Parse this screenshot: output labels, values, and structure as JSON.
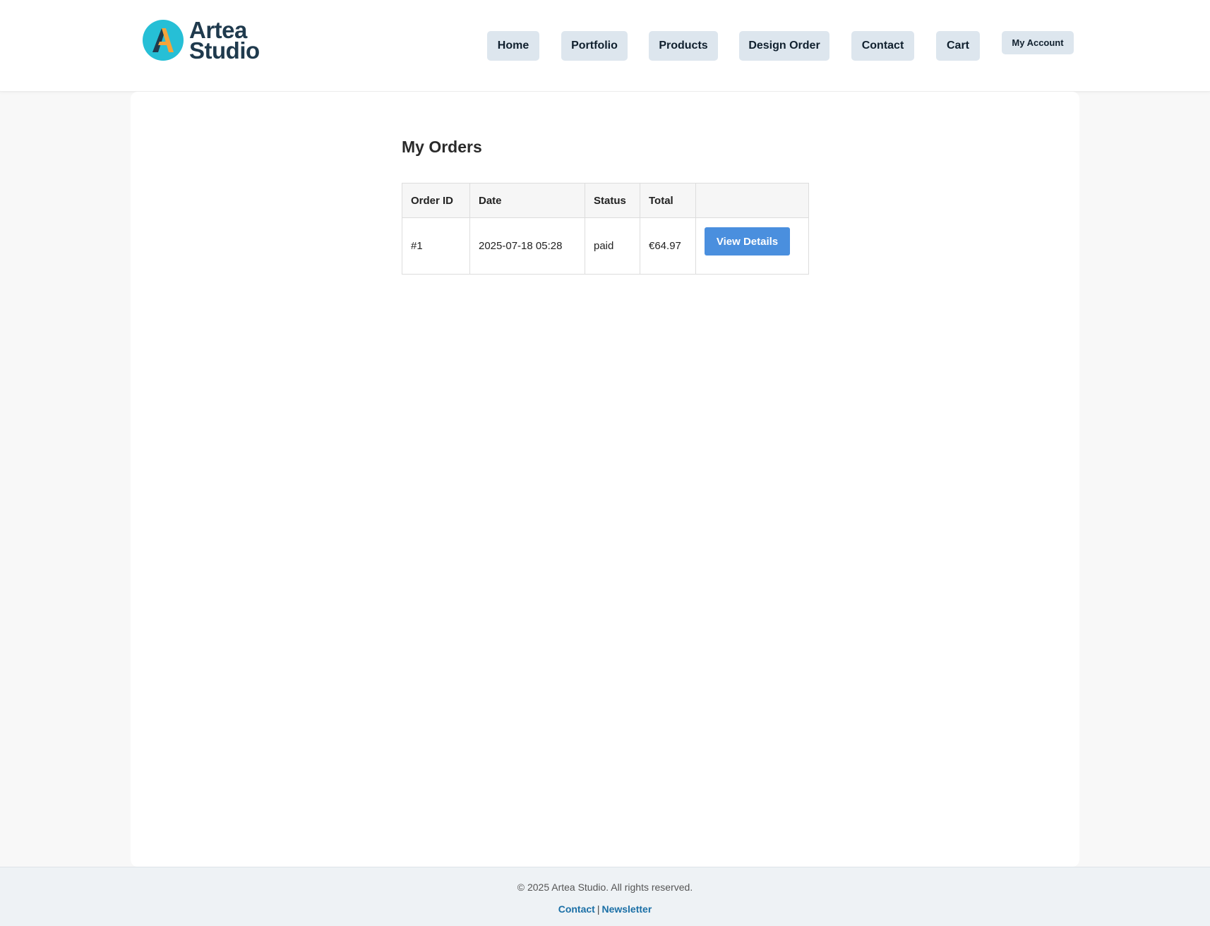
{
  "brand": {
    "name_line1": "Artea",
    "name_line2": "Studio",
    "logo_icon": "artea-a-logo",
    "logo_circle_color": "#26bfd6",
    "logo_accent_color": "#f5a43b"
  },
  "nav": {
    "items": [
      {
        "label": "Home"
      },
      {
        "label": "Portfolio"
      },
      {
        "label": "Products"
      },
      {
        "label": "Design Order"
      },
      {
        "label": "Contact"
      },
      {
        "label": "Cart"
      },
      {
        "label": "My Account"
      }
    ]
  },
  "page": {
    "title": "My Orders"
  },
  "orders": {
    "columns": [
      "Order ID",
      "Date",
      "Status",
      "Total",
      ""
    ],
    "rows": [
      {
        "id": "#1",
        "date": "2025-07-18 05:28",
        "status": "paid",
        "total": "€64.97",
        "action_label": "View Details"
      }
    ]
  },
  "footer": {
    "copyright": "© 2025 Artea Studio. All rights reserved.",
    "links": [
      {
        "label": "Contact"
      },
      {
        "label": "Newsletter"
      }
    ],
    "separator": "|"
  },
  "colors": {
    "primary_button": "#4a8fde",
    "nav_button_bg": "#dde6ee",
    "link": "#1a6fa6"
  }
}
